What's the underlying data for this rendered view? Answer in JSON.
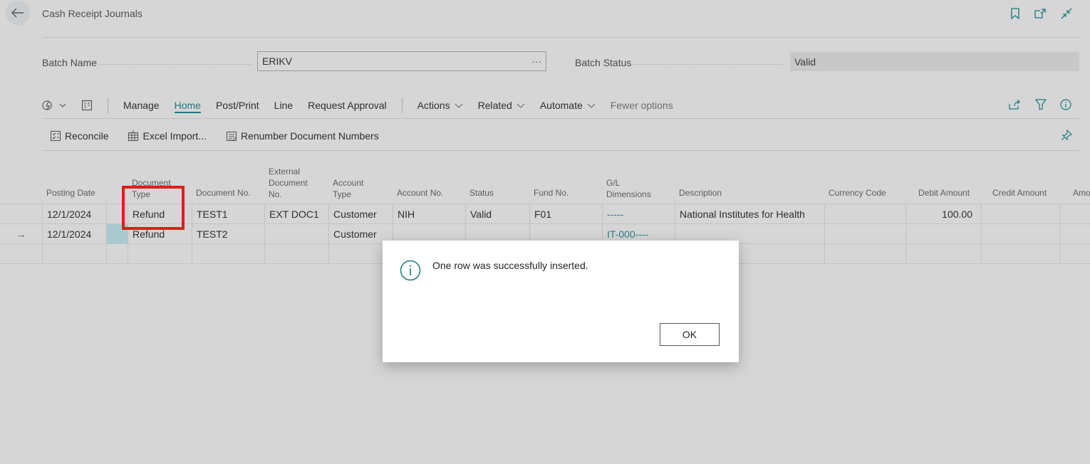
{
  "header": {
    "title": "Cash Receipt Journals",
    "icons": [
      "back-arrow-icon",
      "bookmark-icon",
      "open-new-window-icon",
      "collapse-icon"
    ]
  },
  "batch": {
    "name_label": "Batch Name",
    "name_value": "ERIKV",
    "name_more": "···",
    "status_label": "Batch Status",
    "status_value": "Valid"
  },
  "actions": {
    "manage": "Manage",
    "home": "Home",
    "post_print": "Post/Print",
    "line": "Line",
    "request_approval": "Request Approval",
    "actions": "Actions",
    "related": "Related",
    "automate": "Automate",
    "fewer_options": "Fewer options"
  },
  "promoted": {
    "reconcile": "Reconcile",
    "excel_import": "Excel Import...",
    "renumber": "Renumber Document Numbers"
  },
  "grid": {
    "headers": {
      "posting_date": "Posting Date",
      "document_type_1": "Document",
      "document_type_2": "Type",
      "document_no": "Document No.",
      "external_1": "External",
      "external_2": "Document",
      "external_3": "No.",
      "account_type_1": "Account",
      "account_type_2": "Type",
      "account_no": "Account No.",
      "status": "Status",
      "fund_no": "Fund No.",
      "gl_dim_1": "G/L",
      "gl_dim_2": "Dimensions",
      "description": "Description",
      "currency_code": "Currency Code",
      "debit_amount": "Debit Amount",
      "credit_amount": "Credit Amount",
      "amount": "Amo"
    },
    "rows": [
      {
        "marker": "",
        "posting_date": "12/1/2024",
        "document_type": "Refund",
        "document_no": "TEST1",
        "external_doc": "EXT DOC1",
        "account_type": "Customer",
        "account_no": "NIH",
        "status": "Valid",
        "fund_no": "F01",
        "gl_dimensions": "-----",
        "description": "National Institutes for Health",
        "currency_code": "",
        "debit_amount": "100.00",
        "credit_amount": ""
      },
      {
        "marker": "→",
        "posting_date": "12/1/2024",
        "document_type": "Refund",
        "document_no": "TEST2",
        "external_doc": "",
        "account_type": "Customer",
        "account_no": "",
        "status": "",
        "fund_no": "",
        "gl_dimensions": "IT-000----",
        "description": "",
        "currency_code": "",
        "debit_amount": "",
        "credit_amount": ""
      }
    ]
  },
  "dialog": {
    "message": "One row was successfully inserted.",
    "ok": "OK",
    "icon": "info-icon"
  },
  "colors": {
    "accent": "#1b7a80",
    "highlight": "#e41b17",
    "selected_cell": "#a9c9cf"
  }
}
